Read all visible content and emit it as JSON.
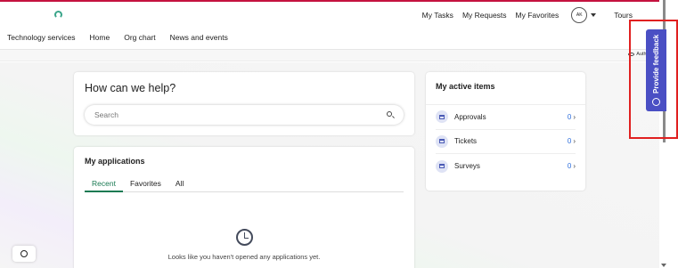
{
  "topbar": {
    "links": [
      "My Tasks",
      "My Requests",
      "My Favorites"
    ],
    "avatar_initials": "AK",
    "tours_label": "Tours"
  },
  "nav": {
    "items": [
      "Technology services",
      "Home",
      "Org chart",
      "News and events"
    ]
  },
  "subbar": {
    "author_label": "Author vi"
  },
  "help": {
    "title": "How can we help?",
    "search_placeholder": "Search"
  },
  "applications": {
    "title": "My applications",
    "tabs": [
      "Recent",
      "Favorites",
      "All"
    ],
    "active_tab": "Recent",
    "empty_message": "Looks like you haven't opened any applications yet."
  },
  "active_items": {
    "title": "My active items",
    "rows": [
      {
        "label": "Approvals",
        "count": "0",
        "icon": "calendar-icon"
      },
      {
        "label": "Tickets",
        "count": "0",
        "icon": "calendar-icon"
      },
      {
        "label": "Surveys",
        "count": "0",
        "icon": "calendar-icon"
      }
    ]
  },
  "feedback": {
    "label": "Provide feedback"
  },
  "colors": {
    "accent_green": "#1a7a53",
    "feedback_purple": "#4a4fc4",
    "link_blue": "#2f6fdc",
    "highlight_red": "#e02020",
    "top_accent": "#c4123f"
  }
}
